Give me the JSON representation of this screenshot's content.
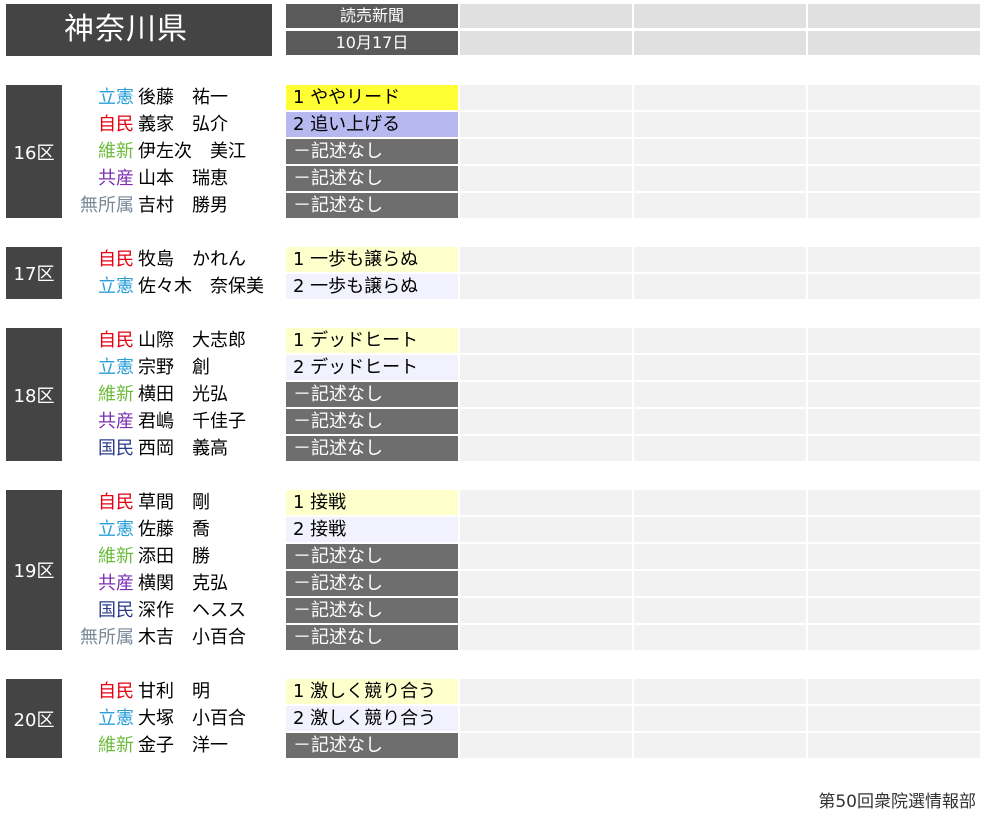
{
  "prefecture": "神奈川県",
  "source": "読売新聞",
  "date": "10月17日",
  "footer": "第50回衆院選情報部",
  "party_colors": {
    "立憲": "#2a9fd8",
    "自民": "#e60012",
    "維新": "#6cbb3c",
    "共産": "#7b2fb5",
    "国民": "#2b3c8c",
    "無所属": "#7a8a9a"
  },
  "rating_styles": {
    "leading": "#ffff33",
    "chasing": "#b8b8f0",
    "close_first": "#ffffcc",
    "close_second": "#f2f2ff",
    "none": "#6e6e6e"
  },
  "districts": [
    {
      "name": "16区",
      "candidates": [
        {
          "party": "立憲",
          "name": "後藤　祐一",
          "rating": "1 ややリード",
          "style": "leading"
        },
        {
          "party": "自民",
          "name": "義家　弘介",
          "rating": "2 追い上げる",
          "style": "chasing"
        },
        {
          "party": "維新",
          "name": "伊左次　美江",
          "rating": "－記述なし",
          "style": "none"
        },
        {
          "party": "共産",
          "name": "山本　瑞恵",
          "rating": "－記述なし",
          "style": "none"
        },
        {
          "party": "無所属",
          "name": "吉村　勝男",
          "rating": "－記述なし",
          "style": "none"
        }
      ]
    },
    {
      "name": "17区",
      "candidates": [
        {
          "party": "自民",
          "name": "牧島　かれん",
          "rating": "1 一歩も譲らぬ",
          "style": "close_first"
        },
        {
          "party": "立憲",
          "name": "佐々木　奈保美",
          "rating": "2 一歩も譲らぬ",
          "style": "close_second"
        }
      ]
    },
    {
      "name": "18区",
      "candidates": [
        {
          "party": "自民",
          "name": "山際　大志郎",
          "rating": "1 デッドヒート",
          "style": "close_first"
        },
        {
          "party": "立憲",
          "name": "宗野　創",
          "rating": "2 デッドヒート",
          "style": "close_second"
        },
        {
          "party": "維新",
          "name": "横田　光弘",
          "rating": "－記述なし",
          "style": "none"
        },
        {
          "party": "共産",
          "name": "君嶋　千佳子",
          "rating": "－記述なし",
          "style": "none"
        },
        {
          "party": "国民",
          "name": "西岡　義高",
          "rating": "－記述なし",
          "style": "none"
        }
      ]
    },
    {
      "name": "19区",
      "candidates": [
        {
          "party": "自民",
          "name": "草間　剛",
          "rating": "1 接戦",
          "style": "close_first"
        },
        {
          "party": "立憲",
          "name": "佐藤　喬",
          "rating": "2 接戦",
          "style": "close_second"
        },
        {
          "party": "維新",
          "name": "添田　勝",
          "rating": "－記述なし",
          "style": "none"
        },
        {
          "party": "共産",
          "name": "横関　克弘",
          "rating": "－記述なし",
          "style": "none"
        },
        {
          "party": "国民",
          "name": "深作　ヘスス",
          "rating": "－記述なし",
          "style": "none"
        },
        {
          "party": "無所属",
          "name": "木吉　小百合",
          "rating": "－記述なし",
          "style": "none"
        }
      ]
    },
    {
      "name": "20区",
      "candidates": [
        {
          "party": "自民",
          "name": "甘利　明",
          "rating": "1 激しく競り合う",
          "style": "close_first"
        },
        {
          "party": "立憲",
          "name": "大塚　小百合",
          "rating": "2 激しく競り合う",
          "style": "close_second"
        },
        {
          "party": "維新",
          "name": "金子　洋一",
          "rating": "－記述なし",
          "style": "none"
        }
      ]
    }
  ]
}
